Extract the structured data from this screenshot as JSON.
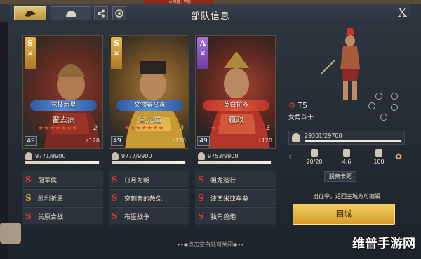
{
  "header": {
    "title": "部队信息",
    "close_label": "X",
    "top_sliver": "(s) 英雄 | 学院"
  },
  "cards": [
    {
      "grade": "S",
      "banner": "竞技新星",
      "banner_color": "blue",
      "name": "霍去病",
      "stars": "★★★★★★★",
      "star_count": "2",
      "level": "49",
      "cost": "120",
      "troops": "9771/9900",
      "troop_fill": 0.987,
      "skills": [
        {
          "icon": "S",
          "type": "red",
          "name": "冠军侯"
        },
        {
          "icon": "S",
          "type": "gold",
          "name": "胜利祈愿"
        },
        {
          "icon": "S",
          "type": "red",
          "name": "关原合战"
        }
      ]
    },
    {
      "grade": "S",
      "banner": "文物鉴赏家",
      "banner_color": "blue",
      "name": "朱元璋",
      "stars": "★★★★★★★",
      "star_count": "3",
      "level": "49",
      "cost": "120",
      "troops": "9777/9900",
      "troop_fill": 0.988,
      "skills": [
        {
          "icon": "S",
          "type": "red",
          "name": "日月为明"
        },
        {
          "icon": "S",
          "type": "red",
          "name": "穿刺者的赦免"
        },
        {
          "icon": "S",
          "type": "red",
          "name": "布匿战争"
        }
      ]
    },
    {
      "grade": "A",
      "banner": "英白拉多",
      "banner_color": "red",
      "name": "嬴政",
      "stars": "★★★★★★★",
      "star_count": "3",
      "level": "49",
      "cost": "120",
      "troops": "9753/9900",
      "troop_fill": 0.985,
      "skills": [
        {
          "icon": "S",
          "type": "red",
          "name": "祖龙巡行"
        },
        {
          "icon": "S",
          "type": "red",
          "name": "波西米亚车垒"
        },
        {
          "icon": "S",
          "type": "red",
          "name": "独角兽炮"
        }
      ]
    }
  ],
  "unit": {
    "tier": "T5",
    "name": "女角斗士",
    "troops": "29301/29700",
    "troop_fill": 0.987,
    "stats": [
      "20/20",
      "4.6",
      "100"
    ],
    "detach_label": "脱离卡死",
    "notice": "出征中，返回主城方可编辑",
    "city_button": "回城"
  },
  "footer": {
    "hint": "点击空白处可关闭",
    "watermark": "维普手游网"
  }
}
